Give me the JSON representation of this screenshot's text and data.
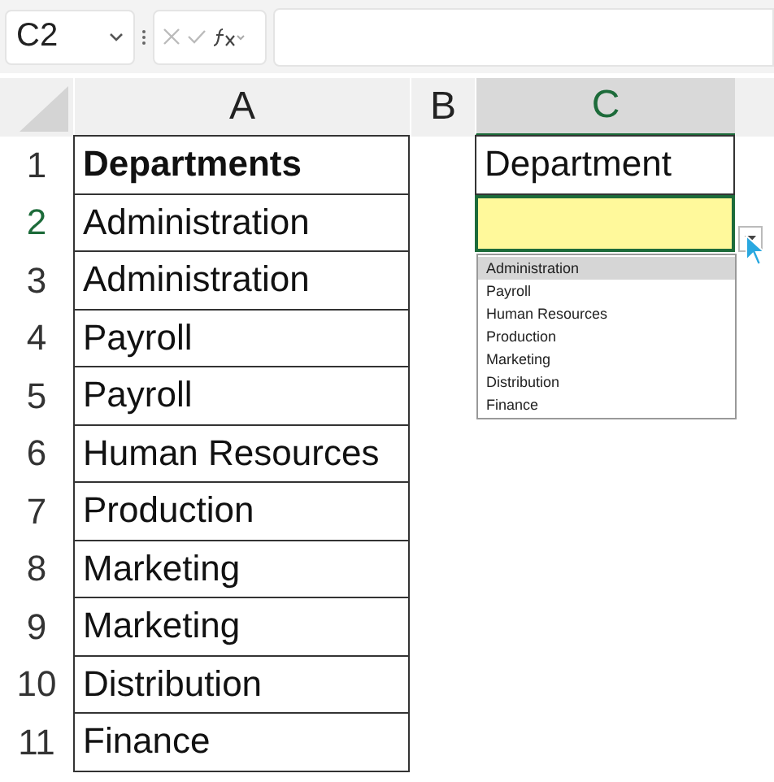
{
  "name_box": {
    "value": "C2"
  },
  "columns": [
    {
      "label": "A",
      "selected": false
    },
    {
      "label": "B",
      "selected": false
    },
    {
      "label": "C",
      "selected": true
    }
  ],
  "rows": [
    {
      "number": "1",
      "selected": false,
      "a": "Departments",
      "a_bold": true,
      "c": "Department",
      "c_active": false
    },
    {
      "number": "2",
      "selected": true,
      "a": "Administration",
      "a_bold": false,
      "c_active": true
    },
    {
      "number": "3",
      "selected": false,
      "a": "Administration",
      "a_bold": false
    },
    {
      "number": "4",
      "selected": false,
      "a": "Payroll",
      "a_bold": false
    },
    {
      "number": "5",
      "selected": false,
      "a": "Payroll",
      "a_bold": false
    },
    {
      "number": "6",
      "selected": false,
      "a": "Human Resources",
      "a_bold": false
    },
    {
      "number": "7",
      "selected": false,
      "a": "Production",
      "a_bold": false
    },
    {
      "number": "8",
      "selected": false,
      "a": "Marketing",
      "a_bold": false
    },
    {
      "number": "9",
      "selected": false,
      "a": "Marketing",
      "a_bold": false
    },
    {
      "number": "10",
      "selected": false,
      "a": "Distribution",
      "a_bold": false
    },
    {
      "number": "11",
      "selected": false,
      "a": "Finance",
      "a_bold": false
    }
  ],
  "dropdown": {
    "items": [
      {
        "label": "Administration",
        "selected": true
      },
      {
        "label": "Payroll",
        "selected": false
      },
      {
        "label": "Human Resources",
        "selected": false
      },
      {
        "label": "Production",
        "selected": false
      },
      {
        "label": "Marketing",
        "selected": false
      },
      {
        "label": "Distribution",
        "selected": false
      },
      {
        "label": "Finance",
        "selected": false
      }
    ]
  }
}
